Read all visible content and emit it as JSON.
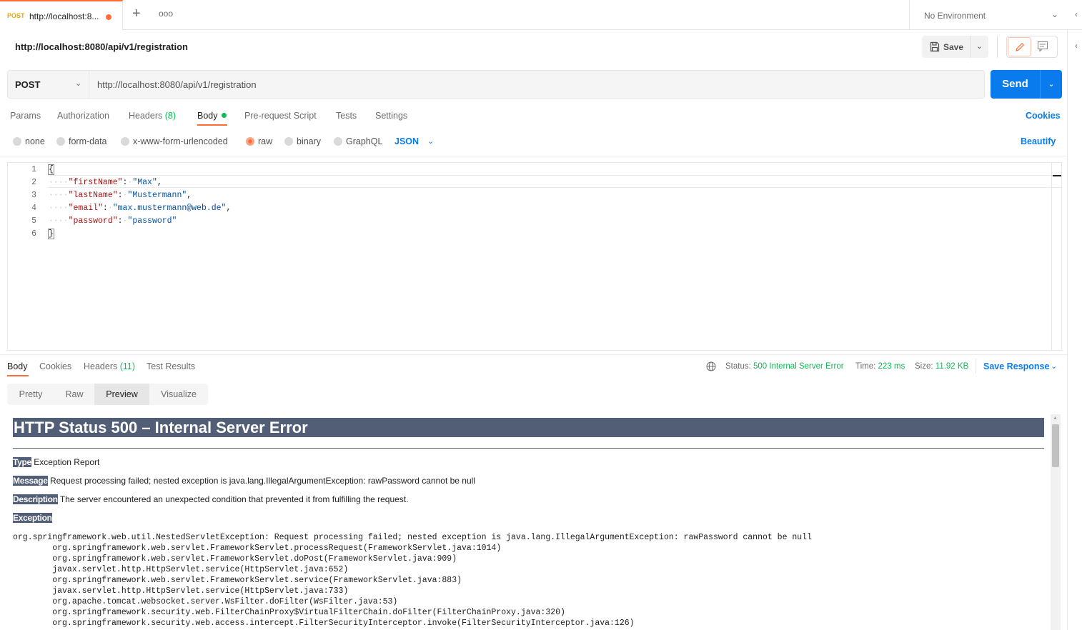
{
  "tabs": [
    {
      "method": "POST",
      "title": "http://localhost:8...",
      "unsaved": true
    }
  ],
  "tabbar": {
    "add_symbol": "+",
    "more_symbol": "ooo"
  },
  "environment": {
    "label": "No Environment"
  },
  "request": {
    "name": "http://localhost:8080/api/v1/registration",
    "method": "POST",
    "url": "http://localhost:8080/api/v1/registration",
    "save_label": "Save",
    "send_label": "Send"
  },
  "request_tabs": {
    "params": "Params",
    "authorization": "Authorization",
    "headers": "Headers",
    "headers_count": "(8)",
    "body": "Body",
    "prerequest": "Pre-request Script",
    "tests": "Tests",
    "settings": "Settings",
    "cookies": "Cookies"
  },
  "body_types": {
    "none": "none",
    "form_data": "form-data",
    "urlencoded": "x-www-form-urlencoded",
    "raw": "raw",
    "binary": "binary",
    "graphql": "GraphQL",
    "selected": "raw",
    "format": "JSON",
    "beautify": "Beautify"
  },
  "editor": {
    "line_numbers": [
      "1",
      "2",
      "3",
      "4",
      "5",
      "6"
    ],
    "lines": [
      {
        "open": "{"
      },
      {
        "key": "\"firstName\"",
        "value": "\"Max\"",
        "comma": ","
      },
      {
        "key": "\"lastName\"",
        "value": "\"Mustermann\"",
        "comma": ","
      },
      {
        "key": "\"email\"",
        "value": "\"max.mustermann@web.de\"",
        "comma": ","
      },
      {
        "key": "\"password\"",
        "value": "\"password\"",
        "comma": ""
      },
      {
        "close": "}"
      }
    ]
  },
  "response_tabs": {
    "body": "Body",
    "cookies": "Cookies",
    "headers": "Headers",
    "headers_count": "(11)",
    "test_results": "Test Results"
  },
  "response_status": {
    "status_label": "Status:",
    "status_value": "500 Internal Server Error",
    "time_label": "Time:",
    "time_value": "223 ms",
    "size_label": "Size:",
    "size_value": "11.92 KB",
    "save_response": "Save Response"
  },
  "view_modes": {
    "pretty": "Pretty",
    "raw": "Raw",
    "preview": "Preview",
    "visualize": "Visualize",
    "selected": "Preview"
  },
  "preview": {
    "title": "HTTP Status 500 – Internal Server Error",
    "type_label": "Type",
    "type_value": "Exception Report",
    "message_label": "Message",
    "message_value": "Request processing failed; nested exception is java.lang.IllegalArgumentException: rawPassword cannot be null",
    "description_label": "Description",
    "description_value": "The server encountered an unexpected condition that prevented it from fulfilling the request.",
    "exception_label": "Exception",
    "stack": "org.springframework.web.util.NestedServletException: Request processing failed; nested exception is java.lang.IllegalArgumentException: rawPassword cannot be null\n\torg.springframework.web.servlet.FrameworkServlet.processRequest(FrameworkServlet.java:1014)\n\torg.springframework.web.servlet.FrameworkServlet.doPost(FrameworkServlet.java:909)\n\tjavax.servlet.http.HttpServlet.service(HttpServlet.java:652)\n\torg.springframework.web.servlet.FrameworkServlet.service(FrameworkServlet.java:883)\n\tjavax.servlet.http.HttpServlet.service(HttpServlet.java:733)\n\torg.apache.tomcat.websocket.server.WsFilter.doFilter(WsFilter.java:53)\n\torg.springframework.security.web.FilterChainProxy$VirtualFilterChain.doFilter(FilterChainProxy.java:320)\n\torg.springframework.security.web.access.intercept.FilterSecurityInterceptor.invoke(FilterSecurityInterceptor.java:126)"
  },
  "colors": {
    "accent_orange": "#ff6c37",
    "primary_blue": "#097bed",
    "success_green": "#0cbb52",
    "tomcat_header": "#525d76"
  }
}
